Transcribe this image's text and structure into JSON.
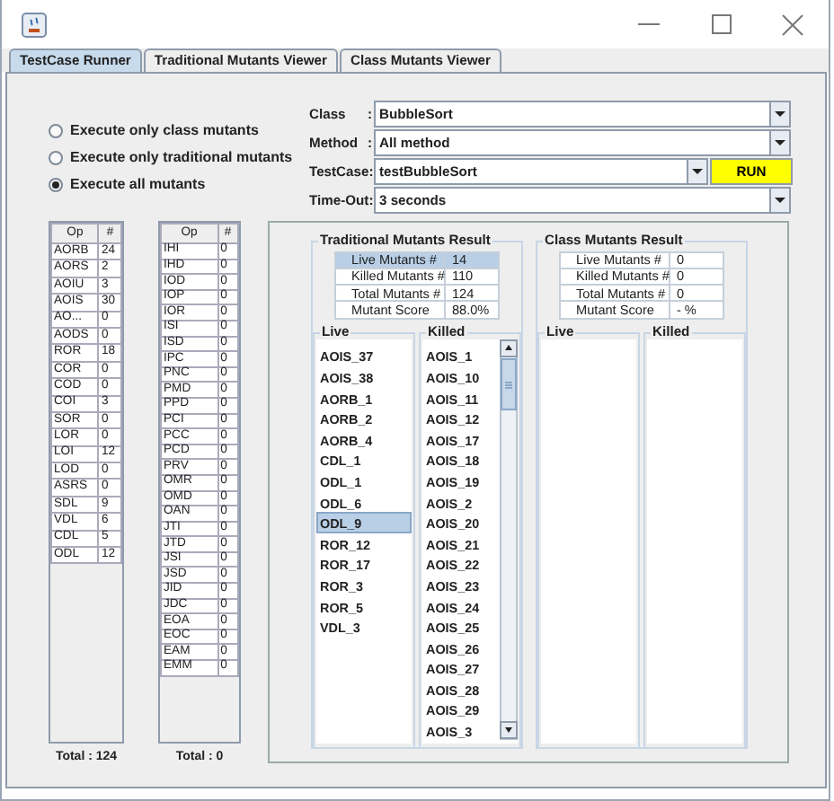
{
  "tabs": [
    {
      "label": "TestCase Runner",
      "selected": true
    },
    {
      "label": "Traditional Mutants Viewer",
      "selected": false
    },
    {
      "label": "Class Mutants Viewer",
      "selected": false
    }
  ],
  "execution_modes": [
    {
      "label": "Execute only class mutants",
      "selected": false
    },
    {
      "label": "Execute only traditional mutants",
      "selected": false
    },
    {
      "label": "Execute all mutants",
      "selected": true
    }
  ],
  "settings": [
    {
      "label": "Class",
      "colon": ":",
      "value": "BubbleSort"
    },
    {
      "label": "Method",
      "colon": ":",
      "value": "All method"
    },
    {
      "label": "TestCase",
      "colon": ":",
      "value": "testBubbleSort",
      "kind": "run"
    },
    {
      "label": "Time-Out",
      "colon": ":",
      "value": "3 seconds"
    }
  ],
  "run_button": "RUN",
  "operator_tables": [
    {
      "columns": [
        "Op",
        "#"
      ],
      "total": "Total : 124",
      "rows": [
        [
          "AORB",
          "24"
        ],
        [
          "AORS",
          "2"
        ],
        [
          "AOIU",
          "3"
        ],
        [
          "AOIS",
          "30"
        ],
        [
          "AO...",
          "0"
        ],
        [
          "AODS",
          "0"
        ],
        [
          "ROR",
          "18"
        ],
        [
          "COR",
          "0"
        ],
        [
          "COD",
          "0"
        ],
        [
          "COI",
          "3"
        ],
        [
          "SOR",
          "0"
        ],
        [
          "LOR",
          "0"
        ],
        [
          "LOI",
          "12"
        ],
        [
          "LOD",
          "0"
        ],
        [
          "ASRS",
          "0"
        ],
        [
          "SDL",
          "9"
        ],
        [
          "VDL",
          "6"
        ],
        [
          "CDL",
          "5"
        ],
        [
          "ODL",
          "12"
        ]
      ]
    },
    {
      "columns": [
        "Op",
        "#"
      ],
      "total": "Total : 0",
      "rows": [
        [
          "IHI",
          "0"
        ],
        [
          "IHD",
          "0"
        ],
        [
          "IOD",
          "0"
        ],
        [
          "IOP",
          "0"
        ],
        [
          "IOR",
          "0"
        ],
        [
          "ISI",
          "0"
        ],
        [
          "ISD",
          "0"
        ],
        [
          "IPC",
          "0"
        ],
        [
          "PNC",
          "0"
        ],
        [
          "PMD",
          "0"
        ],
        [
          "PPD",
          "0"
        ],
        [
          "PCI",
          "0"
        ],
        [
          "PCC",
          "0"
        ],
        [
          "PCD",
          "0"
        ],
        [
          "PRV",
          "0"
        ],
        [
          "OMR",
          "0"
        ],
        [
          "OMD",
          "0"
        ],
        [
          "OAN",
          "0"
        ],
        [
          "JTI",
          "0"
        ],
        [
          "JTD",
          "0"
        ],
        [
          "JSI",
          "0"
        ],
        [
          "JSD",
          "0"
        ],
        [
          "JID",
          "0"
        ],
        [
          "JDC",
          "0"
        ],
        [
          "EOA",
          "0"
        ],
        [
          "EOC",
          "0"
        ],
        [
          "EAM",
          "0"
        ],
        [
          "EMM",
          "0"
        ]
      ]
    }
  ],
  "results": [
    {
      "title": "Traditional Mutants Result",
      "stats": [
        {
          "label": "Live Mutants #",
          "value": "14",
          "selected": true
        },
        {
          "label": "Killed Mutants #",
          "value": "110",
          "selected": false
        },
        {
          "label": "Total Mutants #",
          "value": "124",
          "selected": false
        },
        {
          "label": "Mutant Score",
          "value": "88.0%",
          "selected": false
        }
      ],
      "live": {
        "title": "Live",
        "items": [
          {
            "label": "AOIS_37",
            "selected": false
          },
          {
            "label": "AOIS_38",
            "selected": false
          },
          {
            "label": "AORB_1",
            "selected": false
          },
          {
            "label": "AORB_2",
            "selected": false
          },
          {
            "label": "AORB_4",
            "selected": false
          },
          {
            "label": "CDL_1",
            "selected": false
          },
          {
            "label": "ODL_1",
            "selected": false
          },
          {
            "label": "ODL_6",
            "selected": false
          },
          {
            "label": "ODL_9",
            "selected": true
          },
          {
            "label": "ROR_12",
            "selected": false
          },
          {
            "label": "ROR_17",
            "selected": false
          },
          {
            "label": "ROR_3",
            "selected": false
          },
          {
            "label": "ROR_5",
            "selected": false
          },
          {
            "label": "VDL_3",
            "selected": false
          }
        ]
      },
      "killed": {
        "title": "Killed",
        "scrollable": true,
        "items": [
          {
            "label": "AOIS_1",
            "selected": false
          },
          {
            "label": "AOIS_10",
            "selected": false
          },
          {
            "label": "AOIS_11",
            "selected": false
          },
          {
            "label": "AOIS_12",
            "selected": false
          },
          {
            "label": "AOIS_17",
            "selected": false
          },
          {
            "label": "AOIS_18",
            "selected": false
          },
          {
            "label": "AOIS_19",
            "selected": false
          },
          {
            "label": "AOIS_2",
            "selected": false
          },
          {
            "label": "AOIS_20",
            "selected": false
          },
          {
            "label": "AOIS_21",
            "selected": false
          },
          {
            "label": "AOIS_22",
            "selected": false
          },
          {
            "label": "AOIS_23",
            "selected": false
          },
          {
            "label": "AOIS_24",
            "selected": false
          },
          {
            "label": "AOIS_25",
            "selected": false
          },
          {
            "label": "AOIS_26",
            "selected": false
          },
          {
            "label": "AOIS_27",
            "selected": false
          },
          {
            "label": "AOIS_28",
            "selected": false
          },
          {
            "label": "AOIS_29",
            "selected": false
          },
          {
            "label": "AOIS_3",
            "selected": false
          }
        ]
      }
    },
    {
      "title": "Class Mutants Result",
      "stats": [
        {
          "label": "Live Mutants #",
          "value": "0",
          "selected": false
        },
        {
          "label": "Killed Mutants #",
          "value": "0",
          "selected": false
        },
        {
          "label": "Total Mutants #",
          "value": "0",
          "selected": false
        },
        {
          "label": "Mutant Score",
          "value": "- %",
          "selected": false
        }
      ],
      "live": {
        "title": "Live"
      },
      "killed": {
        "title": "Killed"
      }
    }
  ]
}
